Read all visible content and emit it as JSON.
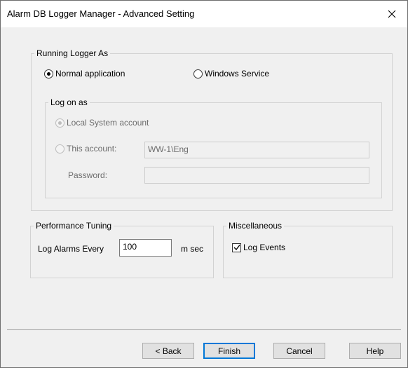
{
  "window": {
    "title": "Alarm DB Logger Manager - Advanced Setting"
  },
  "running": {
    "legend": "Running Logger As",
    "normal_label": "Normal application",
    "service_label": "Windows Service",
    "selected": "normal"
  },
  "logon": {
    "legend": "Log on as",
    "local_label": "Local System account",
    "this_label": "This account:",
    "account_value": "WW-1\\Eng",
    "password_label": "Password:",
    "password_value": ""
  },
  "performance": {
    "legend": "Performance Tuning",
    "log_label": "Log Alarms Every",
    "interval_value": "100",
    "unit": "m sec"
  },
  "misc": {
    "legend": "Miscellaneous",
    "log_events_label": "Log Events",
    "log_events_checked": true
  },
  "buttons": {
    "back": "< Back",
    "finish": "Finish",
    "cancel": "Cancel",
    "help": "Help"
  }
}
